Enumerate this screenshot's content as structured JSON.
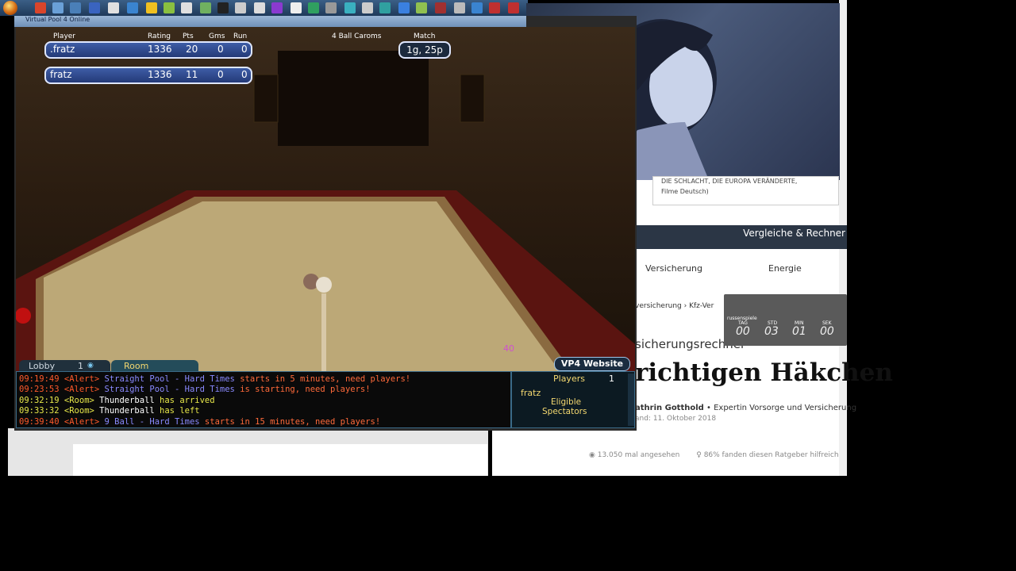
{
  "taskbar": {
    "icons": [
      "start-orb",
      "app-icons"
    ]
  },
  "game": {
    "window_title": "Virtual Pool 4 Online",
    "hud": {
      "headers": {
        "player": "Player",
        "rating": "Rating",
        "pts": "Pts",
        "gms": "Gms",
        "run": "Run",
        "match": "Match"
      },
      "game_type": "4 Ball Caroms",
      "players": [
        {
          "name": ".fratz",
          "rating": "1336",
          "pts": "20",
          "gms": "0",
          "run": "0"
        },
        {
          "name": "fratz",
          "rating": "1336",
          "pts": "11",
          "gms": "0",
          "run": "0"
        }
      ],
      "match_value": "1g, 25p"
    },
    "table_number": "40",
    "tabs": {
      "lobby": "Lobby",
      "lobby_count": "1",
      "room": "Room"
    },
    "vp4_button": "VP4 Website",
    "chat": [
      {
        "time": "09:19:49",
        "tag": "<Alert>",
        "msg": "Straight Pool - Hard Times",
        "tail": " starts in 5 minutes, need players!",
        "color": "#ff5a2a"
      },
      {
        "time": "09:23:53",
        "tag": "<Alert>",
        "msg": "Straight Pool - Hard Times",
        "tail": " is starting, need players!",
        "color": "#ff5a2a"
      },
      {
        "time": "09:32:19",
        "tag": "<Room>",
        "msg": "Thunderball",
        "tail": " has arrived",
        "color": "#e8e84a"
      },
      {
        "time": "09:33:32",
        "tag": "<Room>",
        "msg": "Thunderball",
        "tail": " has left",
        "color": "#e8e84a"
      },
      {
        "time": "09:39:40",
        "tag": "<Alert>",
        "msg": "9 Ball - Hard Times",
        "tail": " starts in 15 minutes, need players!",
        "color": "#ff5a2a"
      }
    ],
    "players_panel": {
      "title": "Players",
      "count": "1",
      "name": "fratz",
      "eligible": "Eligible",
      "spectators": "Spectators"
    }
  },
  "browser": {
    "header_text": "Vergleiche & Rechner",
    "nav": [
      "Versicherung",
      "Energie"
    ],
    "breadcrumb": "versicherung  ›  Kfz-Ver",
    "subheading": "sicherungsrechner",
    "heading": "richtigen Häkchen",
    "author_name": "athrin Gotthold",
    "author_role": "Expertin Vorsorge und Versicherung",
    "date": "and: 11. Oktober 2018",
    "views": "13.050 mal angesehen",
    "helpful": "86% fanden diesen Ratgeber hilfreich"
  },
  "video_caption": {
    "line1": "DIE SCHLACHT, DIE EUROPA VERÄNDERTE,",
    "line2": "Filme Deutsch)"
  },
  "countdown": {
    "header": "russenspiele",
    "labels": [
      "TAG",
      "STD",
      "MIN",
      "SEK"
    ],
    "values": [
      "00",
      "03",
      "01",
      "00"
    ]
  }
}
